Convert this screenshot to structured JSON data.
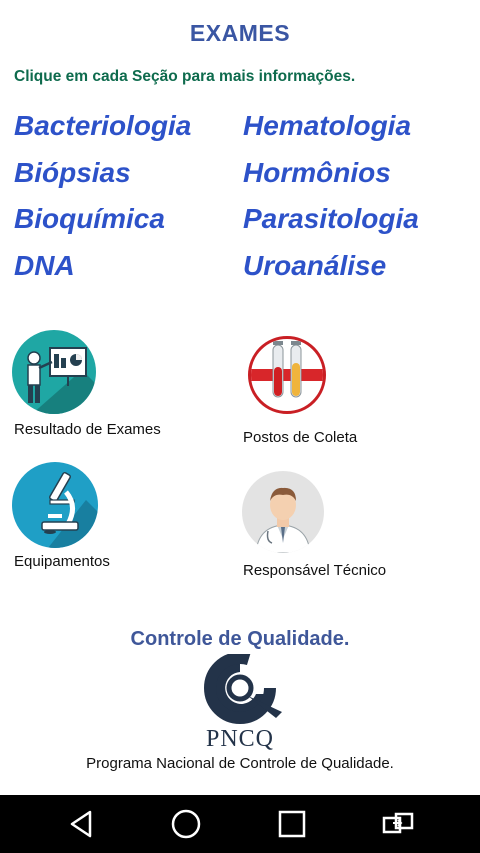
{
  "header": {
    "title": "EXAMES",
    "subtitle": "Clique em cada Seção para mais informações."
  },
  "sections": {
    "left": [
      "Bacteriologia",
      "Biópsias",
      "Bioquímica",
      "DNA"
    ],
    "right": [
      "Hematologia",
      "Hormônios",
      "Parasitologia",
      "Uroanálise"
    ]
  },
  "shortcuts": {
    "results": {
      "label": "Resultado de Exames",
      "icon": "presentation-icon"
    },
    "collection": {
      "label": "Postos de Coleta",
      "icon": "test-tubes-icon"
    },
    "equipment": {
      "label": "Equipamentos",
      "icon": "microscope-icon"
    },
    "technician": {
      "label": "Responsável Técnico",
      "icon": "doctor-icon"
    }
  },
  "quality": {
    "title": "Controle de Qualidade.",
    "logo_text": "PNCQ",
    "program": "Programa Nacional de Controle de Qualidade."
  },
  "colors": {
    "title": "#3a56a3",
    "subtitle": "#0e6b4d",
    "section_link": "#2d52c9",
    "teal": "#1fa7a4",
    "logo": "#233349"
  },
  "navbar": {
    "icons": [
      "back-icon",
      "home-icon",
      "recents-icon",
      "switch-icon"
    ]
  }
}
